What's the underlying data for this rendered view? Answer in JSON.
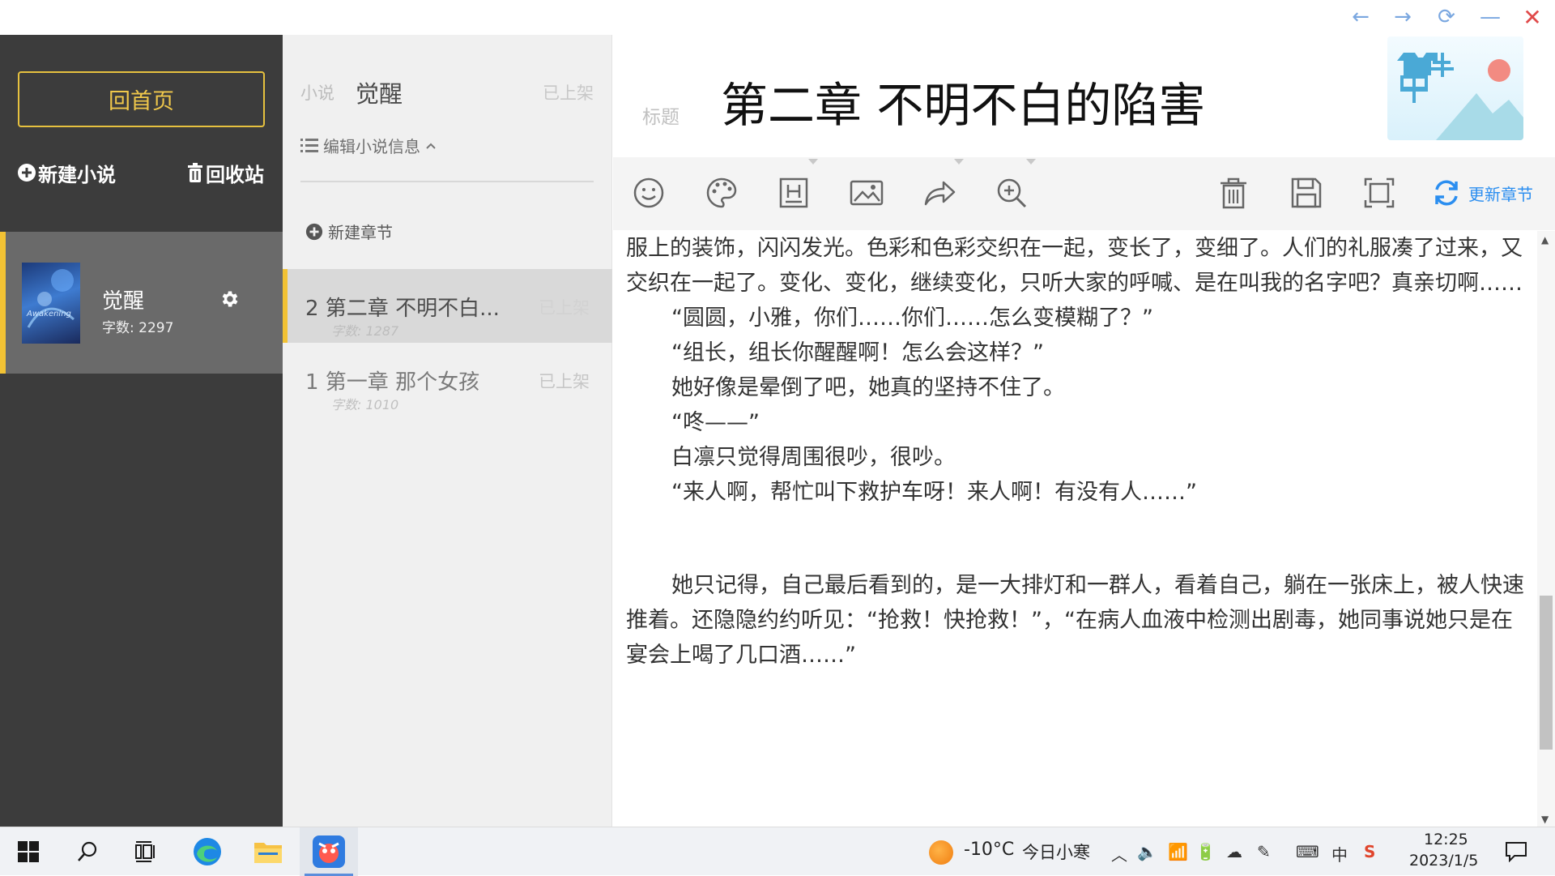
{
  "window": {
    "back_glyph": "←",
    "forward_glyph": "→",
    "refresh_glyph": "⟳",
    "minimize_glyph": "—",
    "close_glyph": "✕"
  },
  "sidebar": {
    "home_label": "回首页",
    "new_novel_label": "新建小说",
    "recycle_label": "回收站",
    "novel": {
      "name": "觉醒",
      "word_count": "字数: 2297",
      "cover_text": "Awakening"
    }
  },
  "chapters": {
    "header_label": "小说",
    "novel_name": "觉醒",
    "header_status": "已上架",
    "edit_info_label": "编辑小说信息",
    "new_chapter_label": "新建章节",
    "items": [
      {
        "title": "2  第二章 不明不白...",
        "status": "已上架",
        "count": "字数: 1287"
      },
      {
        "title": "1  第一章 那个女孩",
        "status": "已上架",
        "count": "字数: 1010"
      }
    ]
  },
  "editor": {
    "title_label": "标题",
    "title": "第二章 不明不白的陷害",
    "update_label": "更新章节",
    "paragraphs": [
      {
        "text": "服上的装饰，闪闪发光。色彩和色彩交织在一起，变长了，变细了。人们的礼服凑了过来，又交织在一起了。变化、变化，继续变化，只听大家的呼喊、是在叫我的名字吧？真亲切啊……",
        "indent": false
      },
      {
        "text": "“圆圆，小雅，你们……你们……怎么变模糊了？”",
        "indent": true
      },
      {
        "text": "“组长，组长你醒醒啊！怎么会这样？”",
        "indent": true
      },
      {
        "text": "她好像是晕倒了吧，她真的坚持不住了。",
        "indent": true
      },
      {
        "text": "“咚——”",
        "indent": true
      },
      {
        "text": "白凛只觉得周围很吵，很吵。",
        "indent": true
      },
      {
        "text": "“来人啊，帮忙叫下救护车呀！来人啊！有没有人……”",
        "indent": true
      },
      {
        "text": "",
        "indent": false,
        "spacer": true
      },
      {
        "text": "她只记得，自己最后看到的，是一大排灯和一群人，看着自己，躺在一张床上，被人快速推着。还隐隐约约听见：“抢救！快抢救！”，“在病人血液中检测出剧毒，她同事说她只是在宴会上喝了几口酒……”",
        "indent": true
      }
    ],
    "tools": [
      "emoji-icon",
      "palette-icon",
      "heading-icon",
      "image-icon",
      "share-icon",
      "zoom-in-icon",
      "trash-icon",
      "save-icon",
      "fullscreen-icon",
      "refresh-icon"
    ]
  },
  "taskbar": {
    "weather_temp": "-10°C",
    "weather_desc": "今日小寒",
    "ime_label": "中",
    "time": "12:25",
    "date": "2023/1/5"
  },
  "colors": {
    "accent_yellow": "#f2c234",
    "sidebar_bg": "#3c3c3c",
    "link_blue": "#2b8ef0"
  }
}
